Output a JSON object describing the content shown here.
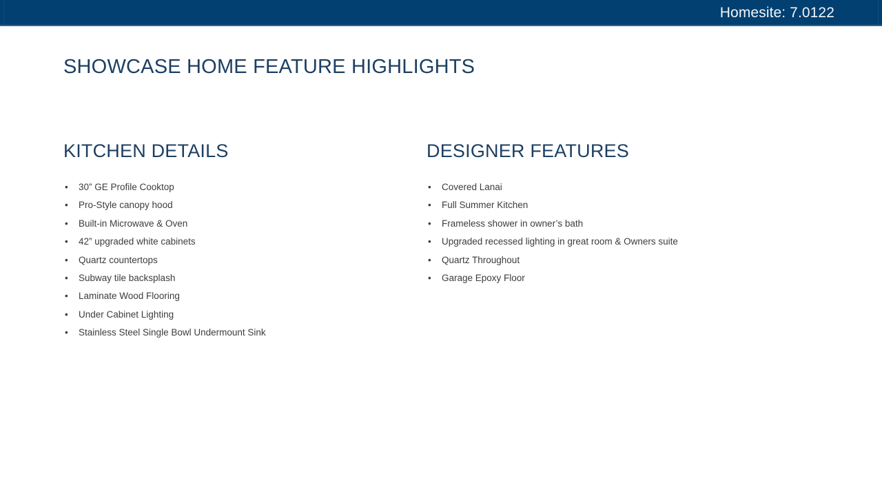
{
  "header": {
    "homesite_label": "Homesite: 7.0122",
    "bar_color": "#014071",
    "underline_color": "#35618c",
    "text_color": "#f2f5f8"
  },
  "slide": {
    "title": "SHOWCASE HOME FEATURE HIGHLIGHTS",
    "title_color": "#1c3f62",
    "background_color": "#ffffff"
  },
  "columns": [
    {
      "heading": "KITCHEN DETAILS",
      "bullet_glyph": "•",
      "items": [
        "30” GE Profile Cooktop",
        "Pro-Style canopy hood",
        "Built-in Microwave & Oven",
        "42” upgraded white cabinets",
        "Quartz countertops",
        "Subway tile backsplash",
        "Laminate Wood Flooring",
        "Under Cabinet Lighting",
        "Stainless Steel Single Bowl Undermount Sink"
      ]
    },
    {
      "heading": "DESIGNER FEATURES",
      "bullet_glyph": "•",
      "items": [
        "Covered Lanai",
        "Full Summer Kitchen",
        "Frameless shower in owner’s bath",
        "Upgraded recessed lighting in great room & Owners suite",
        "Quartz Throughout",
        "Garage Epoxy Floor"
      ]
    }
  ]
}
